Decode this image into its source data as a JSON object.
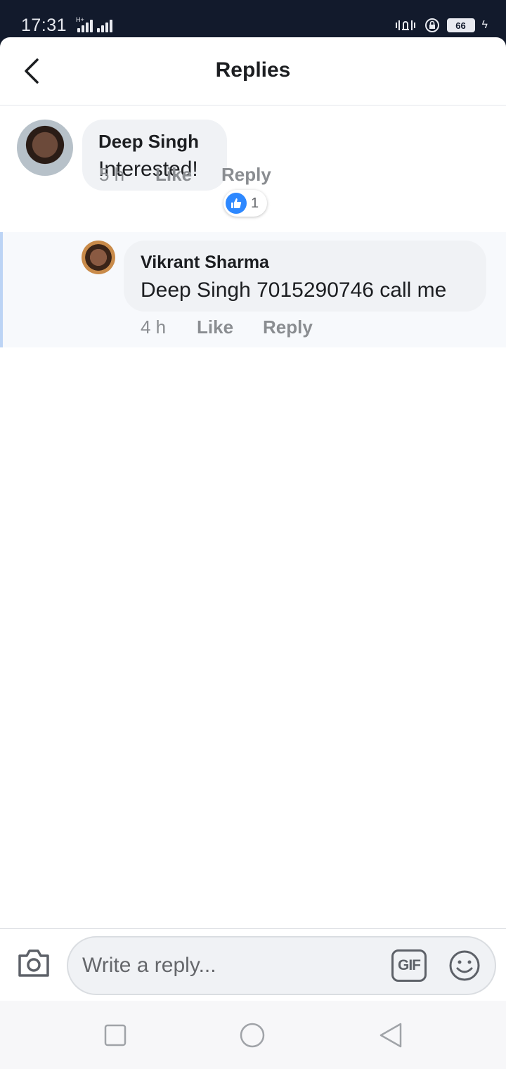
{
  "status_bar": {
    "time": "17:31",
    "network": "H+",
    "battery": "66"
  },
  "header": {
    "title": "Replies",
    "back_icon": "chevron-left-icon"
  },
  "comment": {
    "author": "Deep Singh",
    "text": "Interested!",
    "time": "5 h",
    "like_label": "Like",
    "reply_label": "Reply",
    "reaction_count": "1",
    "reaction_icon": "thumbs-up-icon"
  },
  "reply": {
    "author": "Vikrant Sharma",
    "text": "Deep Singh 7015290746 call me",
    "time": "4 h",
    "like_label": "Like",
    "reply_label": "Reply"
  },
  "composer": {
    "placeholder": "Write a reply...",
    "gif_label": "GIF",
    "camera_icon": "camera-icon",
    "emoji_icon": "smiley-icon"
  },
  "colors": {
    "accent": "#2d88ff",
    "bubble": "#f0f2f5",
    "reply_highlight": "#bcd4f5"
  }
}
